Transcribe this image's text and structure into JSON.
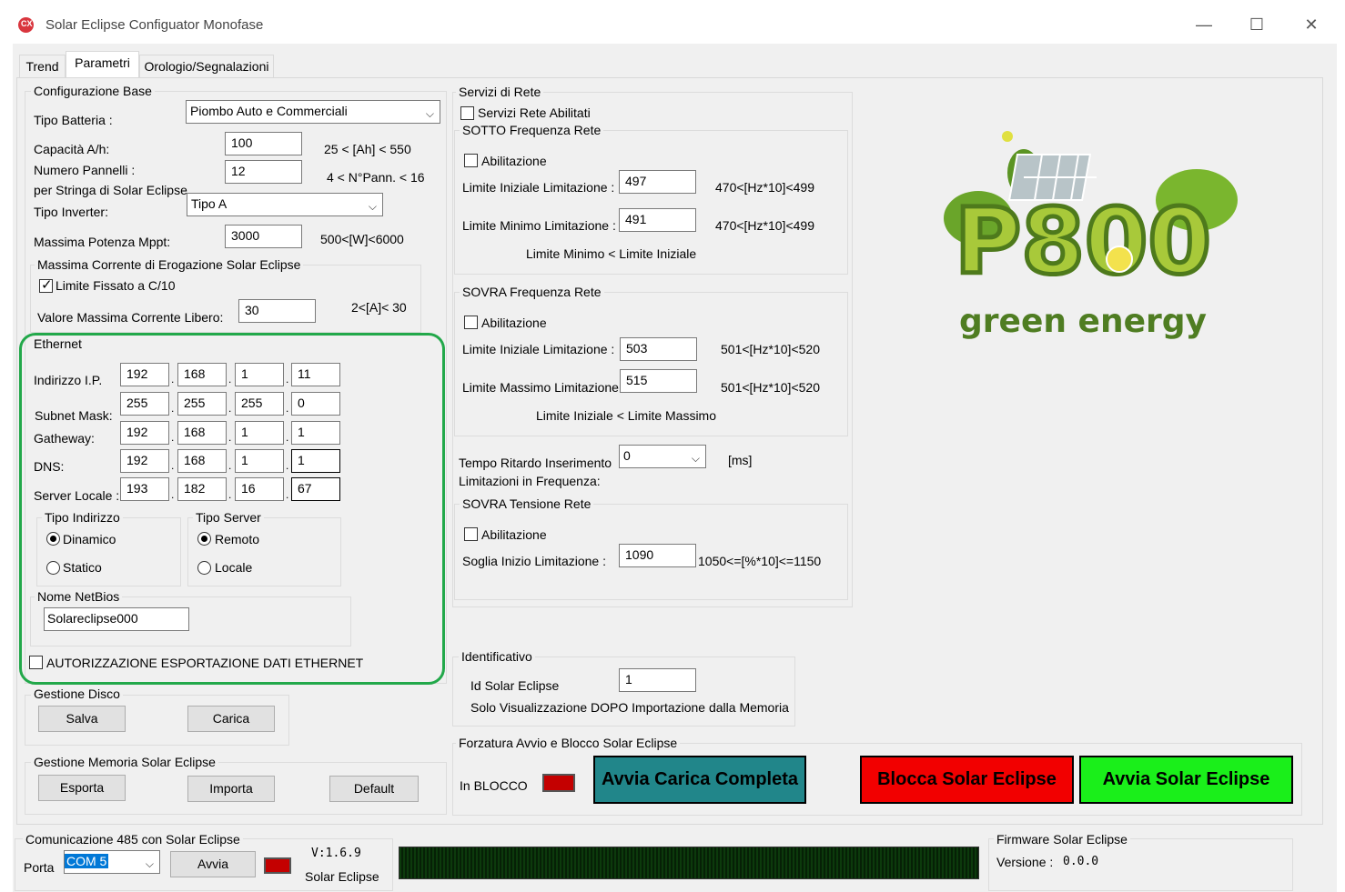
{
  "window": {
    "title": "Solar Eclipse Configuator Monofase",
    "minimize": "—",
    "maximize": "☐",
    "close": "✕"
  },
  "tabs": [
    {
      "label": "Trend"
    },
    {
      "label": "Parametri"
    },
    {
      "label": "Orologio/Segnalazioni"
    }
  ],
  "config": {
    "title": "Configurazione Base",
    "tipo_batteria_label": "Tipo Batteria :",
    "tipo_batteria_value": "Piombo Auto e Commerciali",
    "capacita_label": "Capacità A/h:",
    "capacita_value": "100",
    "capacita_range": "25 < [Ah] < 550",
    "numero_pannelli_label": "Numero Pannelli :",
    "per_stringa_label": "per Stringa di  Solar Eclipse",
    "numero_pannelli_value": "12",
    "numero_pannelli_range": "4 < N°Pann.  <  16",
    "tipo_inverter_label": "Tipo Inverter:",
    "tipo_inverter_value": "Tipo A",
    "potenza_label": "Massima Potenza Mppt:",
    "potenza_value": "3000",
    "potenza_range": "500<[W]<6000",
    "corrente_group": "Massima Corrente di Erogazione Solar Eclipse",
    "limite_fissato_label": "Limite Fissato a C/10",
    "valore_label": "Valore Massima Corrente Libero:",
    "valore_value": "30",
    "valore_range": "2<[A]< 30"
  },
  "ethernet": {
    "title": "Ethernet",
    "ip_label": "Indirizzo I.P.",
    "ip": [
      "192",
      "168",
      "1",
      "11"
    ],
    "subnet_label": "Subnet Mask:",
    "subnet": [
      "255",
      "255",
      "255",
      "0"
    ],
    "gateway_label": "Gatheway:",
    "gateway": [
      "192",
      "168",
      "1",
      "1"
    ],
    "dns_label": "DNS:",
    "dns": [
      "192",
      "168",
      "1",
      "1"
    ],
    "server_label": "Server Locale :",
    "server": [
      "193",
      "182",
      "16",
      "67"
    ],
    "tipo_indirizzo": "Tipo Indirizzo",
    "dinamico": "Dinamico",
    "statico": "Statico",
    "tipo_server": "Tipo Server",
    "remoto": "Remoto",
    "locale": "Locale",
    "netbios_label": "Nome NetBios",
    "netbios_value": "Solareclipse000",
    "autorizzazione": "AUTORIZZAZIONE ESPORTAZIONE DATI ETHERNET",
    "highlight_color": "#22a84a"
  },
  "disco": {
    "title": "Gestione Disco",
    "salva": "Salva",
    "carica": "Carica"
  },
  "memoria": {
    "title": "Gestione Memoria  Solar Eclipse",
    "esporta": "Esporta",
    "importa": "Importa",
    "default": "Default"
  },
  "servizi": {
    "title": "Servizi di Rete",
    "abilitati": "Servizi Rete Abilitati",
    "sotto_title": "SOTTO Frequenza Rete",
    "abilitazione": "Abilitazione",
    "limite_iniziale_label": "Limite Iniziale Limitazione :",
    "sotto_iniziale": "497",
    "sotto_range": "470<[Hz*10]<499",
    "limite_minimo_label": "Limite Minimo Limitazione :",
    "sotto_minimo": "491",
    "sotto_note": "Limite Minimo  < Limite Iniziale",
    "sovra_title": "SOVRA Frequenza Rete",
    "sovra_iniziale": "503",
    "sovra_range": "501<[Hz*10]<520",
    "limite_massimo_label": "Limite Massimo Limitazione :",
    "sovra_massimo": "515",
    "sovra_note": "Limite Iniziale  < Limite Massimo",
    "ritardo_label1": "Tempo Ritardo Inserimento",
    "ritardo_label2": "Limitazioni in Frequenza:",
    "ritardo_value": "0",
    "ritardo_unit": "[ms]",
    "tensione_title": "SOVRA Tensione Rete",
    "soglia_label": "Soglia Inizio Limitazione :",
    "soglia_value": "1090",
    "soglia_range": "1050<=[%*10]<=1150"
  },
  "logo": {
    "text": "P800",
    "tagline": "green energy"
  },
  "ident": {
    "title": "Identificativo",
    "id_label": "Id  Solar Eclipse",
    "id_value": "1",
    "note": "Solo Visualizzazione DOPO Importazione dalla Memoria"
  },
  "forzatura": {
    "title": "Forzatura Avvio e Blocco Solar Eclipse",
    "in_blocco": "In BLOCCO",
    "avvia_carica": "Avvia Carica Completa",
    "blocca": "Blocca Solar Eclipse",
    "avvia": "Avvia Solar Eclipse"
  },
  "comm": {
    "title": "Comunicazione 485 con  Solar Eclipse",
    "porta_label": "Porta",
    "porta_value": "COM 5",
    "avvia": "Avvia",
    "version": "V:1.6.9",
    "product": "Solar Eclipse"
  },
  "firmware": {
    "title": "Firmware  Solar Eclipse",
    "versione_label": "Versione :",
    "versione_value": "0.0.0"
  }
}
